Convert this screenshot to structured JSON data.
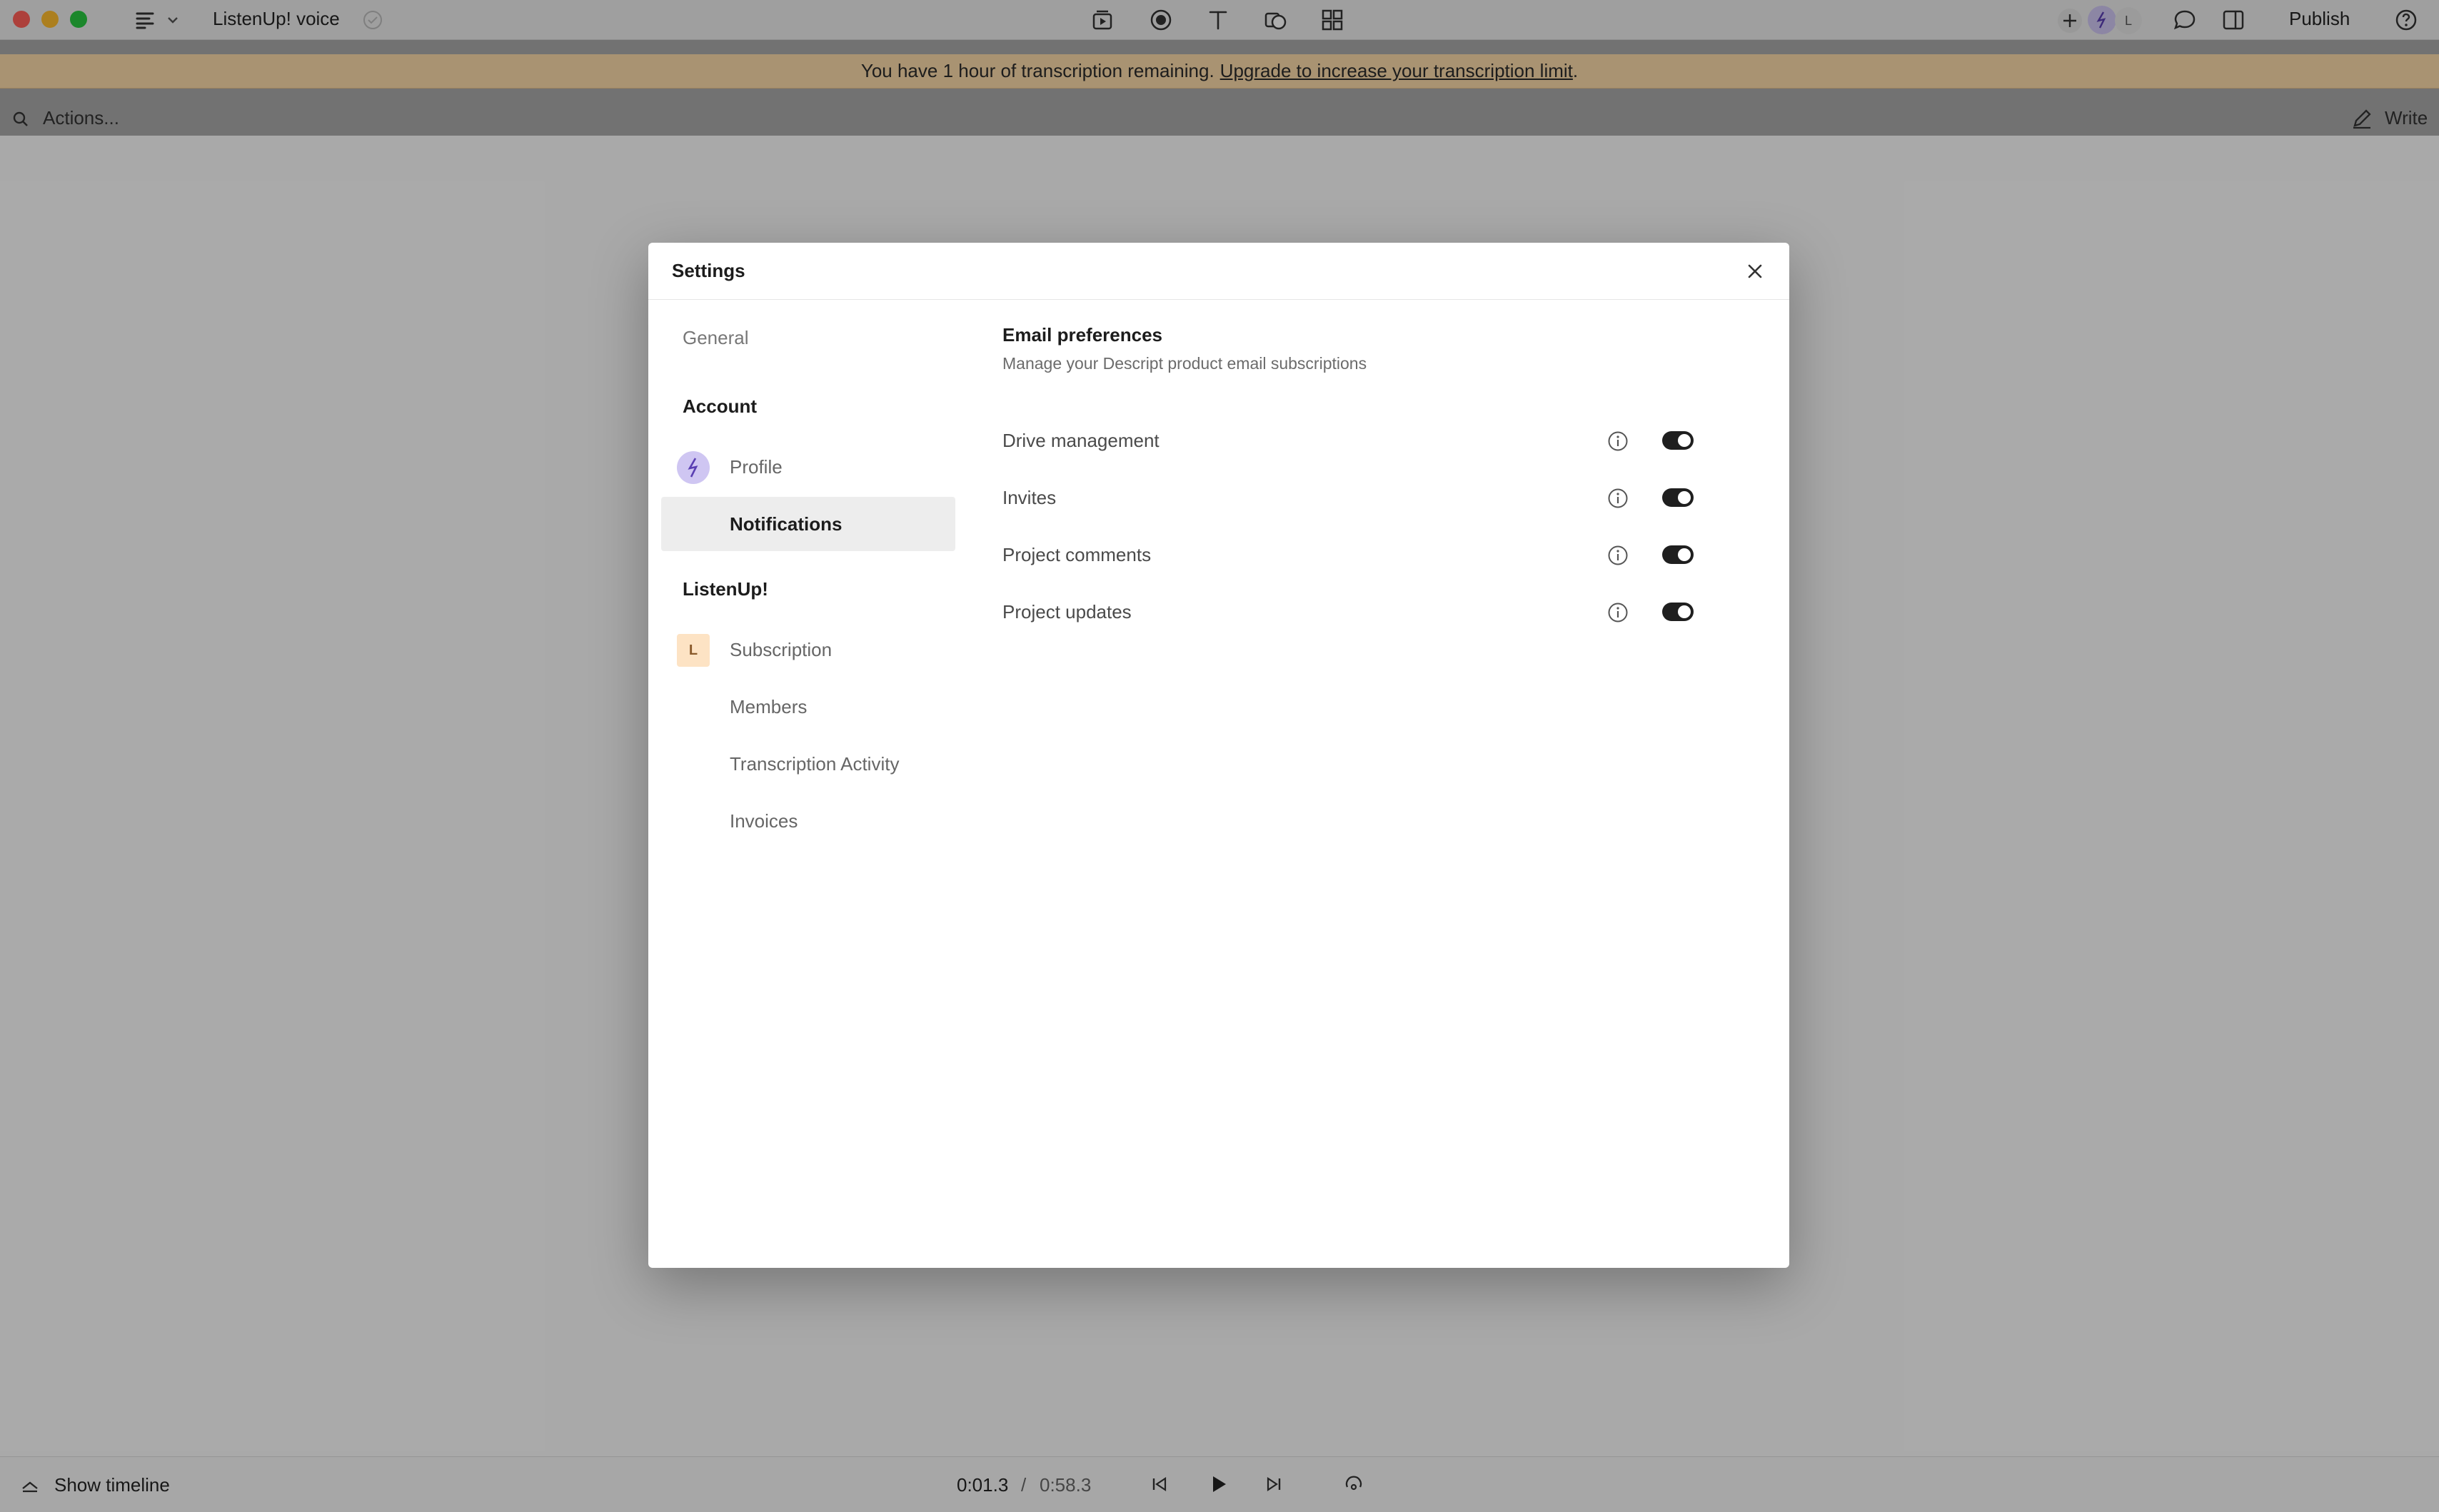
{
  "titlebar": {
    "project_title": "ListenUp! voice",
    "publish_label": "Publish",
    "icons": [
      "menu-icon",
      "chevron-down-icon",
      "sync-check-icon",
      "media-icon",
      "record-icon",
      "text-icon",
      "shapes-icon",
      "grid-icon",
      "plus-icon",
      "avatar-icon",
      "comment-icon",
      "sidebar-icon",
      "help-icon"
    ]
  },
  "banner": {
    "text": "You have 1 hour of transcription remaining.",
    "link": "Upgrade to increase your transcription limit",
    "suffix": ".",
    "color": "#f9d9a8"
  },
  "actionbar": {
    "search_label": "Actions...",
    "write_label": "Write"
  },
  "bottombar": {
    "show_timeline": "Show timeline",
    "current_time": "0:01.3",
    "separator": "/",
    "total_time": "0:58.3"
  },
  "settings": {
    "title": "Settings",
    "nav": {
      "general": "General",
      "account_heading": "Account",
      "profile": "Profile",
      "notifications": "Notifications",
      "org_heading": "ListenUp!",
      "org_initial": "L",
      "subscription": "Subscription",
      "members": "Members",
      "transcription_activity": "Transcription Activity",
      "invoices": "Invoices",
      "active": "Notifications"
    },
    "content": {
      "section_title": "Email preferences",
      "section_subtitle": "Manage your Descript product email subscriptions",
      "preferences": [
        {
          "label": "Drive management",
          "enabled": true
        },
        {
          "label": "Invites",
          "enabled": true
        },
        {
          "label": "Project comments",
          "enabled": true
        },
        {
          "label": "Project updates",
          "enabled": true
        }
      ]
    }
  }
}
